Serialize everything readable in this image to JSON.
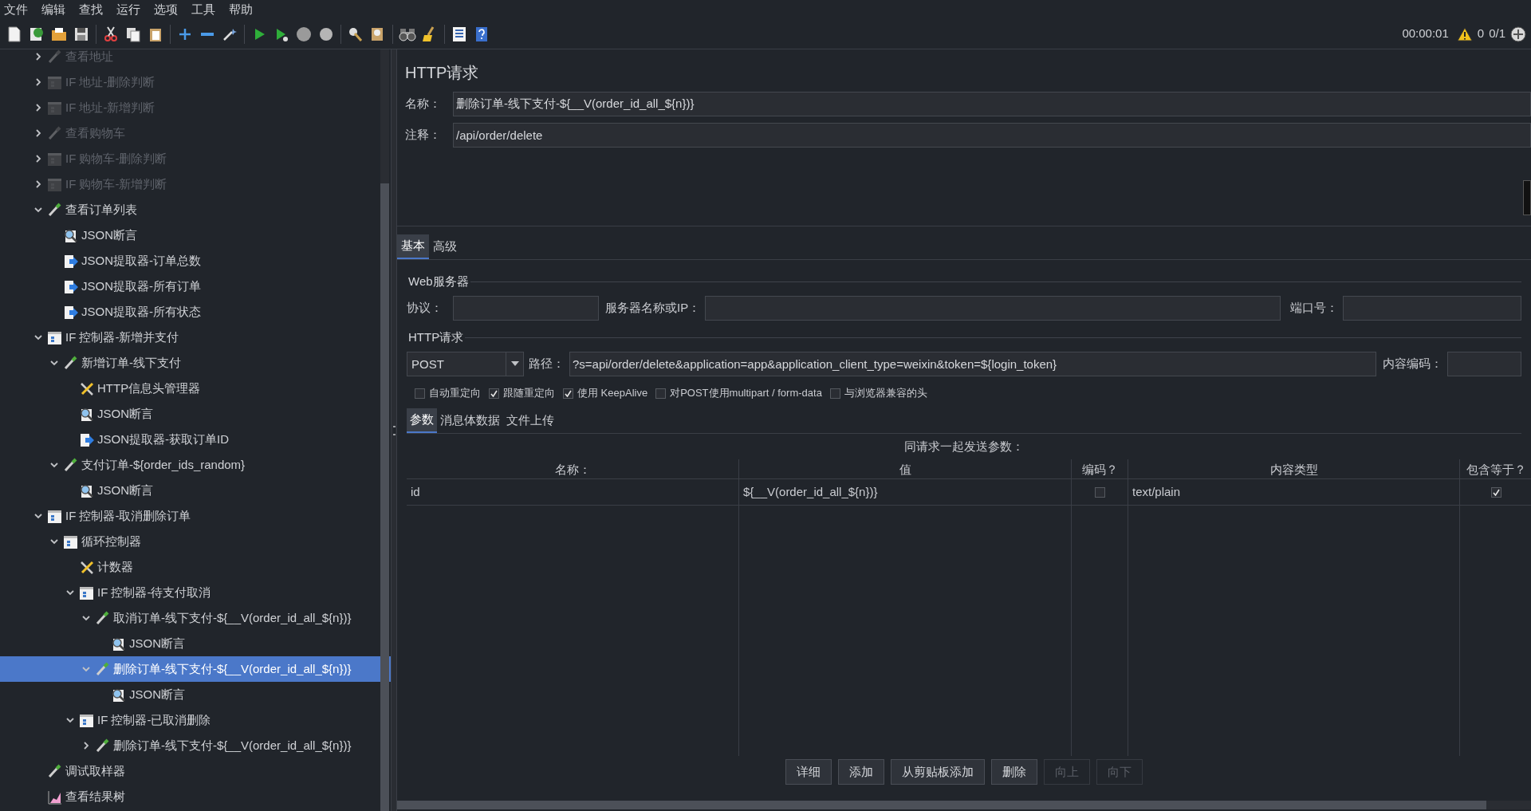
{
  "menu": [
    "文件",
    "编辑",
    "查找",
    "运行",
    "选项",
    "工具",
    "帮助"
  ],
  "toolbar": {
    "timer": "00:00:01",
    "warnings": "0",
    "threads": "0/1"
  },
  "tree": [
    {
      "label": "查看地址",
      "kind": "sampler",
      "expanded": false,
      "disabled": true,
      "selected": false
    },
    {
      "label": "IF 地址-删除判断",
      "kind": "controller",
      "expanded": false,
      "disabled": true,
      "selected": false
    },
    {
      "label": "IF 地址-新增判断",
      "kind": "controller",
      "expanded": false,
      "disabled": true,
      "selected": false
    },
    {
      "label": "查看购物车",
      "kind": "sampler",
      "expanded": false,
      "disabled": true,
      "selected": false
    },
    {
      "label": "IF 购物车-删除判断",
      "kind": "controller",
      "expanded": false,
      "disabled": true,
      "selected": false
    },
    {
      "label": "IF 购物车-新增判断",
      "kind": "controller",
      "expanded": false,
      "disabled": true,
      "selected": false
    },
    {
      "label": "查看订单列表",
      "kind": "sampler",
      "expanded": true,
      "disabled": false,
      "selected": false,
      "children": [
        {
          "label": "JSON断言",
          "kind": "assertion",
          "disabled": false,
          "selected": false
        },
        {
          "label": "JSON提取器-订单总数",
          "kind": "extractor",
          "disabled": false,
          "selected": false
        },
        {
          "label": "JSON提取器-所有订单",
          "kind": "extractor",
          "disabled": false,
          "selected": false
        },
        {
          "label": "JSON提取器-所有状态",
          "kind": "extractor",
          "disabled": false,
          "selected": false
        }
      ]
    },
    {
      "label": "IF 控制器-新增并支付",
      "kind": "controller",
      "expanded": true,
      "disabled": false,
      "selected": false,
      "children": [
        {
          "label": "新增订单-线下支付",
          "kind": "sampler",
          "expanded": true,
          "disabled": false,
          "selected": false,
          "children": [
            {
              "label": "HTTP信息头管理器",
              "kind": "config",
              "disabled": false,
              "selected": false
            },
            {
              "label": "JSON断言",
              "kind": "assertion",
              "disabled": false,
              "selected": false
            },
            {
              "label": "JSON提取器-获取订单ID",
              "kind": "extractor",
              "disabled": false,
              "selected": false
            }
          ]
        },
        {
          "label": "支付订单-${order_ids_random}",
          "kind": "sampler",
          "expanded": true,
          "disabled": false,
          "selected": false,
          "children": [
            {
              "label": "JSON断言",
              "kind": "assertion",
              "disabled": false,
              "selected": false
            }
          ]
        }
      ]
    },
    {
      "label": "IF 控制器-取消删除订单",
      "kind": "controller",
      "expanded": true,
      "disabled": false,
      "selected": false,
      "children": [
        {
          "label": "循环控制器",
          "kind": "controller",
          "expanded": true,
          "disabled": false,
          "selected": false,
          "children": [
            {
              "label": "计数器",
              "kind": "config",
              "disabled": false,
              "selected": false
            },
            {
              "label": "IF 控制器-待支付取消",
              "kind": "controller",
              "expanded": true,
              "disabled": false,
              "selected": false,
              "children": [
                {
                  "label": "取消订单-线下支付-${__V(order_id_all_${n})}",
                  "kind": "sampler",
                  "expanded": true,
                  "disabled": false,
                  "selected": false,
                  "children": [
                    {
                      "label": "JSON断言",
                      "kind": "assertion",
                      "disabled": false,
                      "selected": false
                    }
                  ]
                },
                {
                  "label": "删除订单-线下支付-${__V(order_id_all_${n})}",
                  "kind": "sampler",
                  "expanded": true,
                  "disabled": false,
                  "selected": true,
                  "children": [
                    {
                      "label": "JSON断言",
                      "kind": "assertion",
                      "disabled": false,
                      "selected": false
                    }
                  ]
                }
              ]
            },
            {
              "label": "IF 控制器-已取消删除",
              "kind": "controller",
              "expanded": true,
              "disabled": false,
              "selected": false,
              "children": [
                {
                  "label": "删除订单-线下支付-${__V(order_id_all_${n})}",
                  "kind": "sampler",
                  "expanded": false,
                  "disabled": false,
                  "selected": false
                }
              ]
            }
          ]
        }
      ]
    },
    {
      "label": "调试取样器",
      "kind": "sampler",
      "disabled": false,
      "selected": false
    },
    {
      "label": "查看结果树",
      "kind": "listener",
      "disabled": false,
      "selected": false
    }
  ],
  "panel": {
    "title": "HTTP请求",
    "name_label": "名称：",
    "name_value": "删除订单-线下支付-${__V(order_id_all_${n})}",
    "comment_label": "注释：",
    "comment_value": "/api/order/delete",
    "tabs": [
      {
        "label": "基本",
        "selected": true
      },
      {
        "label": "高级",
        "selected": false
      }
    ],
    "web_server": {
      "legend": "Web服务器",
      "protocol_label": "协议：",
      "server_label": "服务器名称或IP：",
      "port_label": "端口号："
    },
    "http_request": {
      "legend": "HTTP请求",
      "method": "POST",
      "path_label": "路径：",
      "path": "?s=api/order/delete&application=app&application_client_type=weixin&token=${login_token}",
      "encoding_label": "内容编码："
    },
    "options": [
      {
        "label": "自动重定向",
        "checked": false
      },
      {
        "label": "跟随重定向",
        "checked": true
      },
      {
        "label": "使用 KeepAlive",
        "checked": true
      },
      {
        "label": "对POST使用multipart / form-data",
        "checked": false
      },
      {
        "label": "与浏览器兼容的头",
        "checked": false
      }
    ],
    "subtabs": [
      {
        "label": "参数",
        "selected": true
      },
      {
        "label": "消息体数据",
        "selected": false
      },
      {
        "label": "文件上传",
        "selected": false
      }
    ],
    "params_caption": "同请求一起发送参数：",
    "columns": [
      "名称：",
      "值",
      "编码？",
      "内容类型",
      "包含等于？"
    ],
    "rows": [
      {
        "name": "id",
        "value": "${__V(order_id_all_${n})}",
        "encode": false,
        "content_type": "text/plain",
        "include_equals": true
      }
    ],
    "buttons": [
      {
        "label": "详细",
        "disabled": false
      },
      {
        "label": "添加",
        "disabled": false
      },
      {
        "label": "从剪贴板添加",
        "disabled": false
      },
      {
        "label": "删除",
        "disabled": false
      },
      {
        "label": "向上",
        "disabled": true
      },
      {
        "label": "向下",
        "disabled": true
      }
    ]
  }
}
